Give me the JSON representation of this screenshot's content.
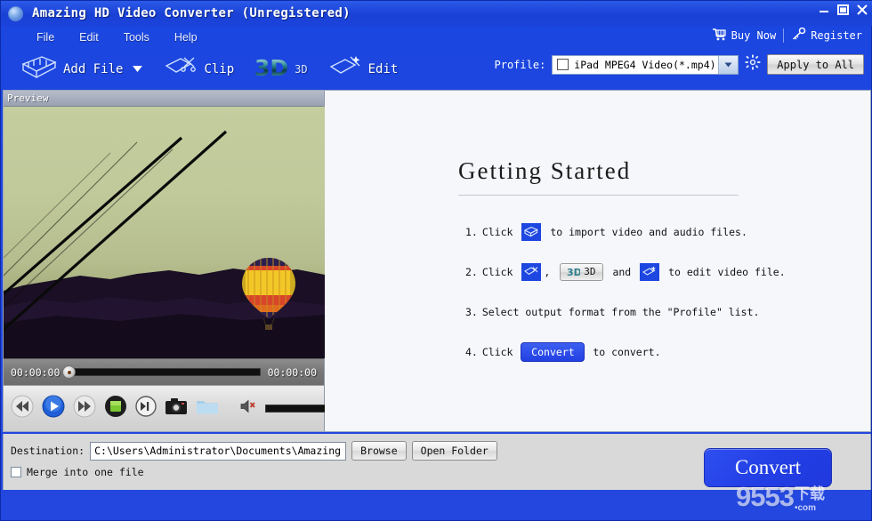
{
  "window": {
    "title": "Amazing HD Video Converter (Unregistered)",
    "app_icon": "globe-icon",
    "minimize": "minimize-icon",
    "maximize": "maximize-icon",
    "close": "close-icon"
  },
  "menubar": {
    "items": [
      {
        "label": "File"
      },
      {
        "label": "Edit"
      },
      {
        "label": "Tools"
      },
      {
        "label": "Help"
      }
    ],
    "buy_now": {
      "label": "Buy Now",
      "icon": "shopping-cart-icon"
    },
    "register": {
      "label": "Register",
      "icon": "key-icon"
    }
  },
  "toolbar": {
    "buttons": [
      {
        "label": "Add File",
        "icon": "film-strip-icon",
        "has_dropdown": true
      },
      {
        "label": "Clip",
        "icon": "scissors-clip-icon",
        "has_dropdown": false
      },
      {
        "label": "3D",
        "icon": "three-d-icon",
        "has_dropdown": false
      },
      {
        "label": "Edit",
        "icon": "magic-wand-edit-icon",
        "has_dropdown": false
      }
    ],
    "profile_label": "Profile:",
    "profile_value": "iPad MPEG4 Video(*.mp4)",
    "settings_icon": "gear-icon",
    "apply_to_all": "Apply to All"
  },
  "preview": {
    "header": "Preview",
    "current_time": "00:00:00",
    "total_time": "00:00:00",
    "seek_position_percent": 0,
    "volume_percent": 100,
    "controls": [
      {
        "name": "rewind-icon"
      },
      {
        "name": "play-icon"
      },
      {
        "name": "fast-forward-icon"
      },
      {
        "name": "stop-icon"
      },
      {
        "name": "step-forward-icon"
      },
      {
        "name": "snapshot-camera-icon"
      },
      {
        "name": "open-folder-icon"
      }
    ],
    "volume_icon": "speaker-muted-icon"
  },
  "getting_started": {
    "title": "Getting Started",
    "steps": [
      {
        "number": "1.",
        "pre": "Click ",
        "icons": [
          "add-file-icon"
        ],
        "post": " to import video and audio files."
      },
      {
        "number": "2.",
        "pre": "Click ",
        "icons": [
          "clip-icon",
          "three-d-button",
          "edit-icon"
        ],
        "mid1": ", ",
        "three_d_label": "3D",
        "mid2": " and ",
        "post": " to edit video file."
      },
      {
        "number": "3.",
        "text": "Select output format from the \"Profile\" list."
      },
      {
        "number": "4.",
        "pre": "Click ",
        "button_label": "Convert",
        "post": " to convert."
      }
    ]
  },
  "bottom": {
    "destination_label": "Destination:",
    "destination_path": "C:\\Users\\Administrator\\Documents\\Amazing Studio\\",
    "browse_label": "Browse",
    "open_folder_label": "Open Folder",
    "merge_label": "Merge into one file",
    "merge_checked": false,
    "convert_label": "Convert"
  },
  "watermark": {
    "number": "9553",
    "cn": "下载",
    "com": "•com"
  },
  "colors": {
    "window_blue": "#1f45dd",
    "accent": "#2340e4",
    "panel_bg": "#f5f7fb",
    "bottom_bg": "#d9d9d9"
  }
}
